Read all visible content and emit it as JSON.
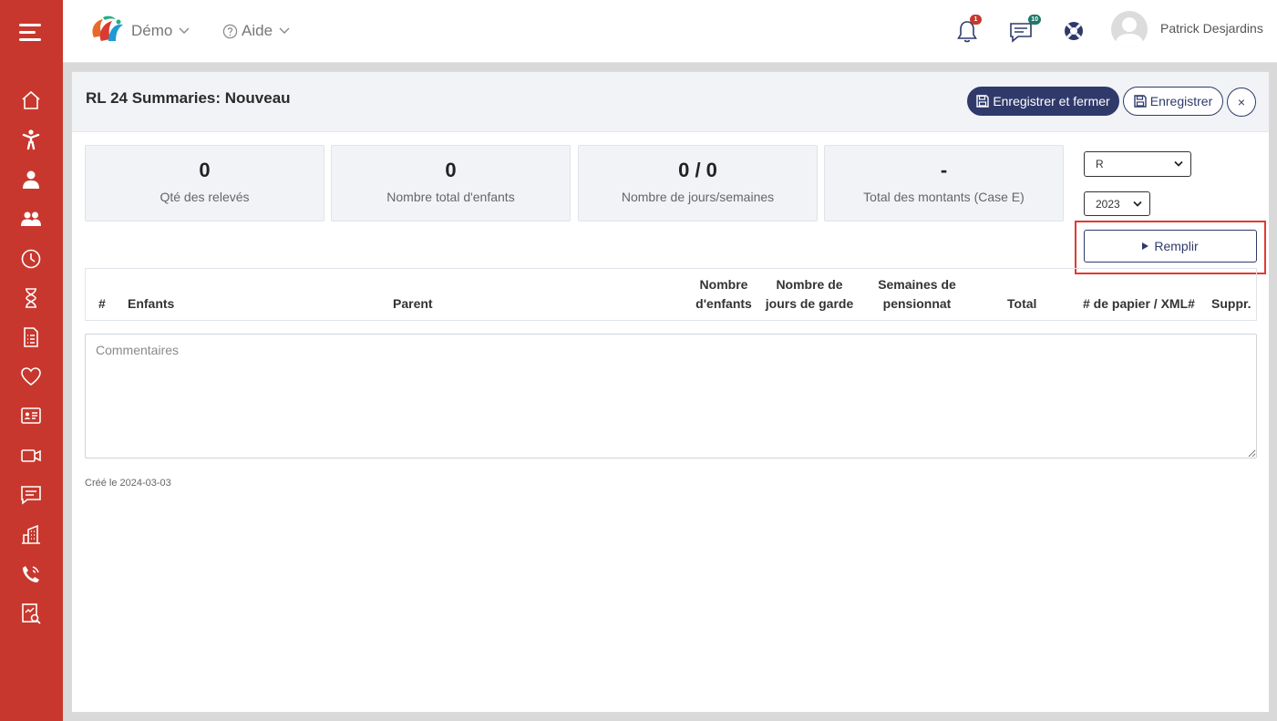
{
  "topbar": {
    "org_menu": "Démo",
    "help_menu": "Aide",
    "notifications_count": "1",
    "messages_count": "10",
    "user_name": "Patrick Desjardins"
  },
  "panel": {
    "title": "RL 24 Summaries: Nouveau",
    "save_close_label": "Enregistrer et fermer",
    "save_label": "Enregistrer",
    "close_label": "×"
  },
  "stats": [
    {
      "value": "0",
      "label": "Qté des relevés"
    },
    {
      "value": "0",
      "label": "Nombre total d'enfants"
    },
    {
      "value": "0 / 0",
      "label": "Nombre de jours/semaines"
    },
    {
      "value": "-",
      "label": "Total des montants (Case E)"
    }
  ],
  "filters": {
    "type_selected": "R",
    "year_selected": "2023",
    "fill_label": "Remplir"
  },
  "table": {
    "columns": [
      {
        "l1": "",
        "l2": "#"
      },
      {
        "l1": "",
        "l2": "Enfants"
      },
      {
        "l1": "",
        "l2": "Parent"
      },
      {
        "l1": "Nombre",
        "l2": "d'enfants"
      },
      {
        "l1": "Nombre de",
        "l2": "jours de garde"
      },
      {
        "l1": "Semaines de",
        "l2": "pensionnat"
      },
      {
        "l1": "",
        "l2": "Total"
      },
      {
        "l1": "",
        "l2": "# de papier / XML#"
      },
      {
        "l1": "",
        "l2": "Suppr."
      }
    ]
  },
  "comments": {
    "placeholder": "Commentaires",
    "value": ""
  },
  "footer": {
    "created": "Créé le 2024-03-03"
  },
  "colors": {
    "sidebar": "#c8372d",
    "primary": "#2f3a6b",
    "highlight": "#e03a32"
  }
}
